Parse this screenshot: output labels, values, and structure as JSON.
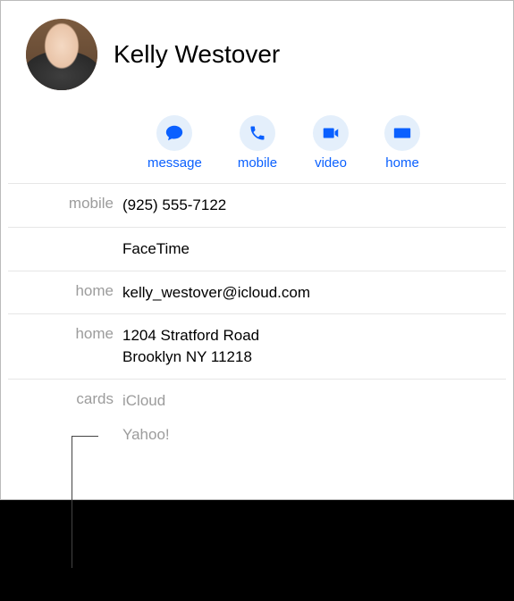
{
  "contact": {
    "name": "Kelly Westover"
  },
  "actions": {
    "message": "message",
    "mobile": "mobile",
    "video": "video",
    "home": "home"
  },
  "fields": {
    "mobile_label": "mobile",
    "mobile_value": "(925) 555-7122",
    "facetime_value": "FaceTime",
    "email_label": "home",
    "email_value": "kelly_westover@icloud.com",
    "addr_label": "home",
    "addr_line1": "1204 Stratford Road",
    "addr_line2": "Brooklyn NY 11218",
    "cards_label": "cards",
    "cards_1": "iCloud",
    "cards_2": "Yahoo!"
  }
}
